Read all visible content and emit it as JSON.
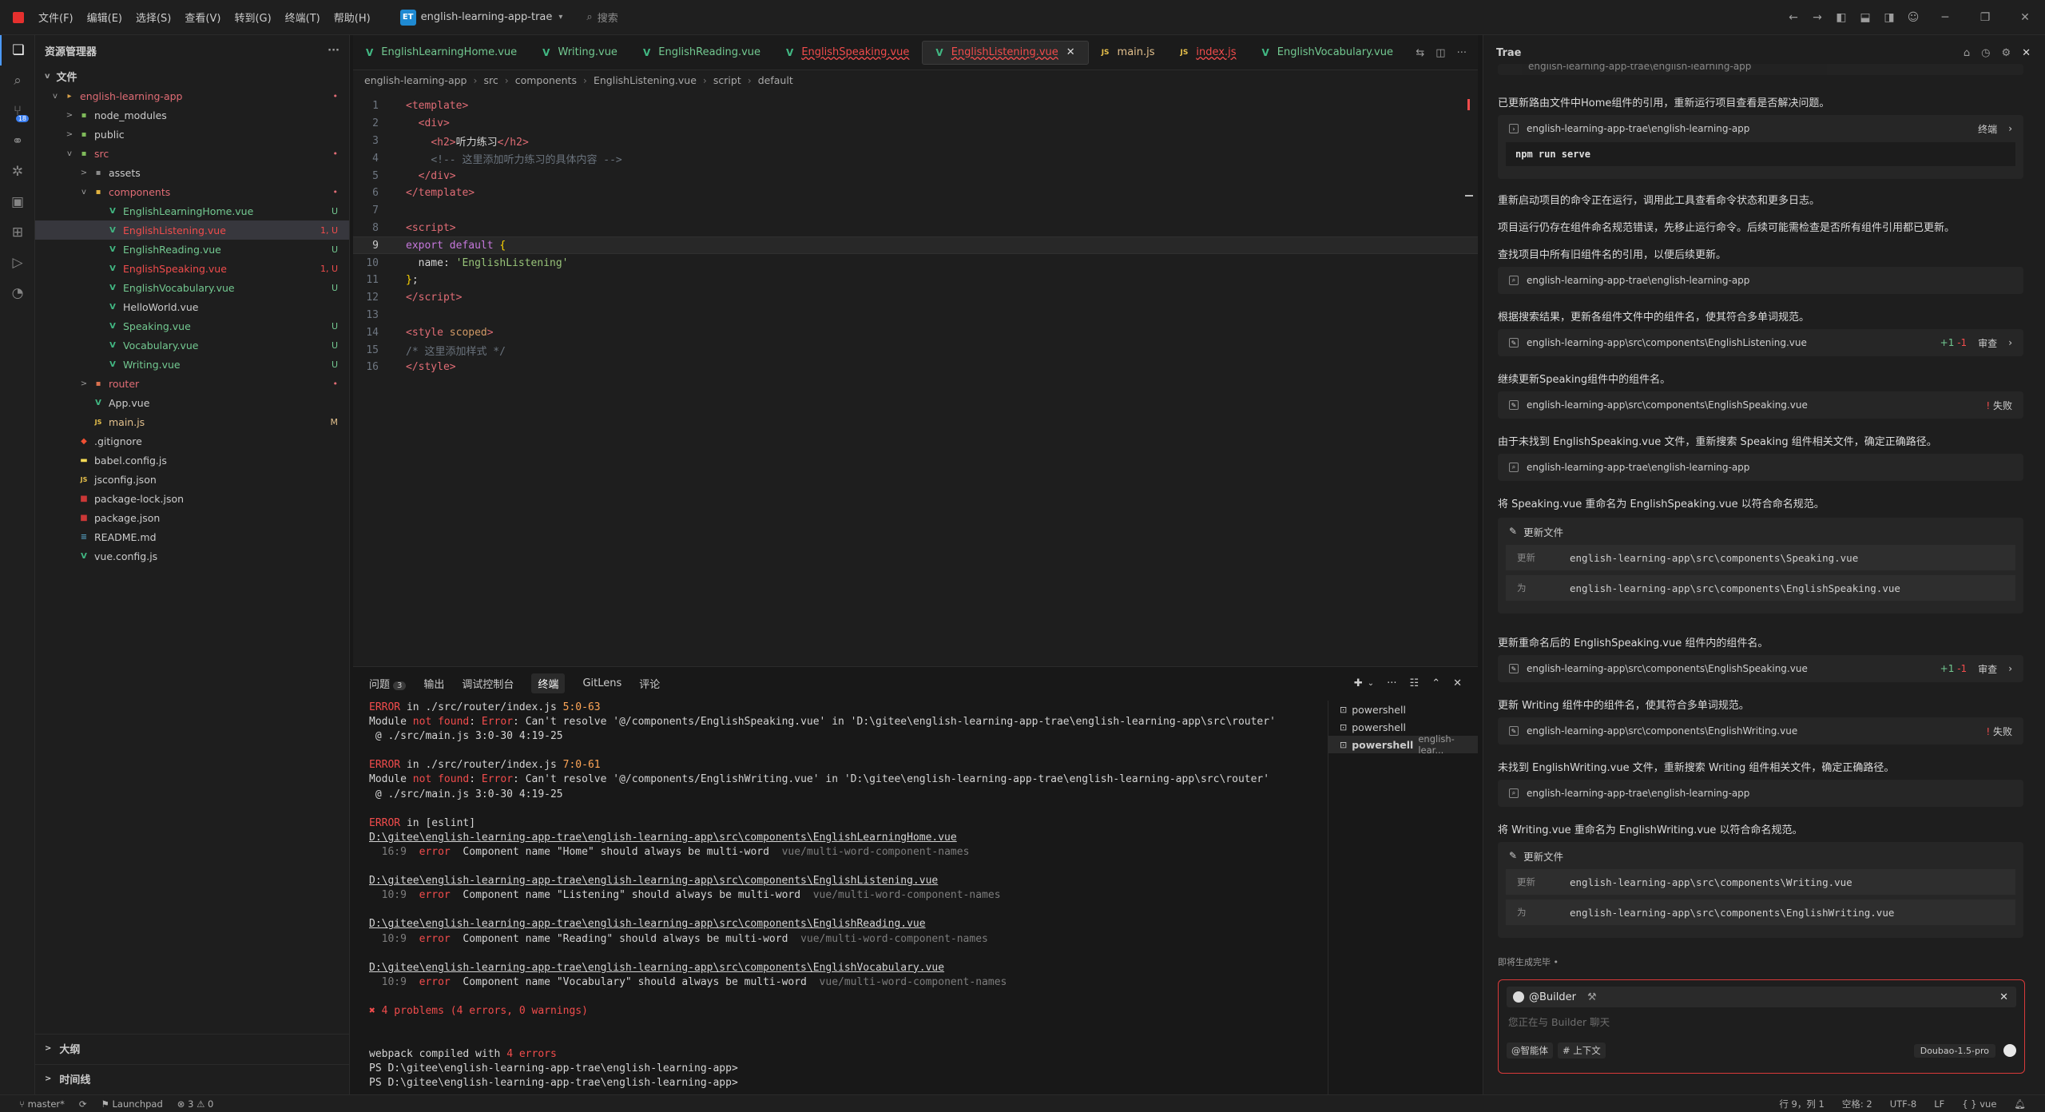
{
  "titlebar": {
    "menu": [
      "文件(F)",
      "编辑(E)",
      "选择(S)",
      "查看(V)",
      "转到(G)",
      "终端(T)",
      "帮助(H)"
    ],
    "project_badge": "ET",
    "project_name": "english-learning-app-trae",
    "search_placeholder": "搜索"
  },
  "activity": {
    "badge": "18"
  },
  "explorer": {
    "title": "资源管理器",
    "more": "···",
    "section": "文件",
    "tree": [
      {
        "label": "english-learning-app",
        "depth": 0,
        "chev": "v",
        "icon": "folder",
        "color": "pink",
        "badge": "•"
      },
      {
        "label": "node_modules",
        "depth": 1,
        "chev": ">",
        "icon": "folder-green",
        "color": "",
        "badge": ""
      },
      {
        "label": "public",
        "depth": 1,
        "chev": ">",
        "icon": "folder-green",
        "color": "",
        "badge": ""
      },
      {
        "label": "src",
        "depth": 1,
        "chev": "v",
        "icon": "folder-green",
        "color": "pink",
        "badge": "•"
      },
      {
        "label": "assets",
        "depth": 2,
        "chev": ">",
        "icon": "folder-grey",
        "color": "",
        "badge": ""
      },
      {
        "label": "components",
        "depth": 2,
        "chev": "v",
        "icon": "folder-yellow",
        "color": "pink",
        "badge": "•"
      },
      {
        "label": "EnglishLearningHome.vue",
        "depth": 3,
        "chev": "",
        "icon": "vue",
        "color": "green",
        "badge": "U"
      },
      {
        "label": "EnglishListening.vue",
        "depth": 3,
        "chev": "",
        "icon": "vue",
        "color": "red",
        "badge": "1, U",
        "selected": true
      },
      {
        "label": "EnglishReading.vue",
        "depth": 3,
        "chev": "",
        "icon": "vue",
        "color": "green",
        "badge": "U"
      },
      {
        "label": "EnglishSpeaking.vue",
        "depth": 3,
        "chev": "",
        "icon": "vue",
        "color": "red",
        "badge": "1, U"
      },
      {
        "label": "EnglishVocabulary.vue",
        "depth": 3,
        "chev": "",
        "icon": "vue",
        "color": "green",
        "badge": "U"
      },
      {
        "label": "HelloWorld.vue",
        "depth": 3,
        "chev": "",
        "icon": "vue",
        "color": "",
        "badge": ""
      },
      {
        "label": "Speaking.vue",
        "depth": 3,
        "chev": "",
        "icon": "vue",
        "color": "green",
        "badge": "U"
      },
      {
        "label": "Vocabulary.vue",
        "depth": 3,
        "chev": "",
        "icon": "vue",
        "color": "green",
        "badge": "U"
      },
      {
        "label": "Writing.vue",
        "depth": 3,
        "chev": "",
        "icon": "vue",
        "color": "green",
        "badge": "U"
      },
      {
        "label": "router",
        "depth": 2,
        "chev": ">",
        "icon": "folder-red",
        "color": "pink",
        "badge": "•"
      },
      {
        "label": "App.vue",
        "depth": 2,
        "chev": "",
        "icon": "vue",
        "color": "",
        "badge": ""
      },
      {
        "label": "main.js",
        "depth": 2,
        "chev": "",
        "icon": "js",
        "color": "yellow",
        "badge": "M"
      },
      {
        "label": ".gitignore",
        "depth": 1,
        "chev": "",
        "icon": "git",
        "color": "",
        "badge": ""
      },
      {
        "label": "babel.config.js",
        "depth": 1,
        "chev": "",
        "icon": "babel",
        "color": "",
        "badge": ""
      },
      {
        "label": "jsconfig.json",
        "depth": 1,
        "chev": "",
        "icon": "js",
        "color": "",
        "badge": ""
      },
      {
        "label": "package-lock.json",
        "depth": 1,
        "chev": "",
        "icon": "npm",
        "color": "",
        "badge": ""
      },
      {
        "label": "package.json",
        "depth": 1,
        "chev": "",
        "icon": "npm",
        "color": "",
        "badge": ""
      },
      {
        "label": "README.md",
        "depth": 1,
        "chev": "",
        "icon": "md",
        "color": "",
        "badge": ""
      },
      {
        "label": "vue.config.js",
        "depth": 1,
        "chev": "",
        "icon": "vue",
        "color": "",
        "badge": ""
      }
    ],
    "outline": "大纲",
    "timeline": "时间线"
  },
  "editor": {
    "tabs": [
      {
        "label": "EnglishLearningHome.vue",
        "icon": "V",
        "color": "green"
      },
      {
        "label": "Writing.vue",
        "icon": "V",
        "color": "green"
      },
      {
        "label": "EnglishReading.vue",
        "icon": "V",
        "color": "green"
      },
      {
        "label": "EnglishSpeaking.vue",
        "icon": "V",
        "color": "red-wavy"
      },
      {
        "label": "EnglishListening.vue",
        "icon": "V",
        "color": "red-wavy",
        "active": true
      },
      {
        "label": "main.js",
        "icon": "JS",
        "color": "yellow"
      },
      {
        "label": "index.js",
        "icon": "JS",
        "color": "red-wavy"
      },
      {
        "label": "EnglishVocabulary.vue",
        "icon": "V",
        "color": "green"
      }
    ],
    "breadcrumb": [
      "english-learning-app",
      "src",
      "components",
      "EnglishListening.vue",
      "script",
      "default"
    ],
    "lines": [
      {
        "n": "1",
        "html": "<span class='tok-tag'>&lt;template&gt;</span>"
      },
      {
        "n": "2",
        "html": "  <span class='tok-tag'>&lt;div&gt;</span>"
      },
      {
        "n": "3",
        "html": "    <span class='tok-tag'>&lt;h2&gt;</span><span class='tok-text'>听力练习</span><span class='tok-tag'>&lt;/h2&gt;</span>"
      },
      {
        "n": "4",
        "html": "    <span class='tok-cmt'>&lt;!-- 这里添加听力练习的具体内容 --&gt;</span>"
      },
      {
        "n": "5",
        "html": "  <span class='tok-tag'>&lt;/div&gt;</span>"
      },
      {
        "n": "6",
        "html": "<span class='tok-tag'>&lt;/template&gt;</span>"
      },
      {
        "n": "7",
        "html": ""
      },
      {
        "n": "8",
        "html": "<span class='tok-tag'>&lt;script&gt;</span>"
      },
      {
        "n": "9",
        "html": "<span class='tok-kw'>export default</span> <span class='tok-punc'>{</span>",
        "current": true
      },
      {
        "n": "10",
        "html": "  <span class='tok-text'>name</span><span class='tok-text'>: </span><span class='tok-str'>'EnglishListening'</span>"
      },
      {
        "n": "11",
        "html": "<span class='tok-punc'>}</span><span class='tok-text'>;</span>"
      },
      {
        "n": "12",
        "html": "<span class='tok-tag'>&lt;/script&gt;</span>"
      },
      {
        "n": "13",
        "html": ""
      },
      {
        "n": "14",
        "html": "<span class='tok-tag'>&lt;style</span> <span class='tok-attr'>scoped</span><span class='tok-tag'>&gt;</span>"
      },
      {
        "n": "15",
        "html": "<span class='tok-cmt'>/* 这里添加样式 */</span>"
      },
      {
        "n": "16",
        "html": "<span class='tok-tag'>&lt;/style&gt;</span>"
      }
    ]
  },
  "panel": {
    "tabs": [
      {
        "label": "问题",
        "badge": "3"
      },
      {
        "label": "输出"
      },
      {
        "label": "调试控制台"
      },
      {
        "label": "终端",
        "active": true
      },
      {
        "label": "GitLens"
      },
      {
        "label": "评论"
      }
    ],
    "terminal_lines": [
      "<span class='err'>ERROR</span> in ./src/router/index.js <span class='amber'>5:0-63</span>",
      "Module <span class='err'>not found</span>: <span class='err'>Error</span>: Can't resolve '@/components/EnglishSpeaking.vue' in 'D:\\gitee\\english-learning-app-trae\\english-learning-app\\src\\router'",
      " @ ./src/main.js 3:0-30 4:19-25",
      "",
      "<span class='err'>ERROR</span> in ./src/router/index.js <span class='amber'>7:0-61</span>",
      "Module <span class='err'>not found</span>: <span class='err'>Error</span>: Can't resolve '@/components/EnglishWriting.vue' in 'D:\\gitee\\english-learning-app-trae\\english-learning-app\\src\\router'",
      " @ ./src/main.js 3:0-30 4:19-25",
      "",
      "<span class='err'>ERROR</span> in [eslint]",
      "<span class='ulink'>D:\\gitee\\english-learning-app-trae\\english-learning-app\\src\\components\\EnglishLearningHome.vue</span>",
      "  <span class='dim'>16:9</span>  <span class='errlabel'>error</span>  Component name \"Home\" should always be multi-word  <span class='dim'>vue/multi-word-component-names</span>",
      "",
      "<span class='ulink'>D:\\gitee\\english-learning-app-trae\\english-learning-app\\src\\components\\EnglishListening.vue</span>",
      "  <span class='dim'>10:9</span>  <span class='errlabel'>error</span>  Component name \"Listening\" should always be multi-word  <span class='dim'>vue/multi-word-component-names</span>",
      "",
      "<span class='ulink'>D:\\gitee\\english-learning-app-trae\\english-learning-app\\src\\components\\EnglishReading.vue</span>",
      "  <span class='dim'>10:9</span>  <span class='errlabel'>error</span>  Component name \"Reading\" should always be multi-word  <span class='dim'>vue/multi-word-component-names</span>",
      "",
      "<span class='ulink'>D:\\gitee\\english-learning-app-trae\\english-learning-app\\src\\components\\EnglishVocabulary.vue</span>",
      "  <span class='dim'>10:9</span>  <span class='errlabel'>error</span>  Component name \"Vocabulary\" should always be multi-word  <span class='dim'>vue/multi-word-component-names</span>",
      "",
      "<span class='err'>✖ 4 problems (4 errors, 0 warnings)</span>",
      "",
      "",
      "webpack compiled with <span class='err'>4 errors</span>",
      "PS D:\\gitee\\english-learning-app-trae\\english-learning-app>",
      "PS D:\\gitee\\english-learning-app-trae\\english-learning-app>"
    ],
    "terminal_list": [
      {
        "label": "powershell",
        "extra": ""
      },
      {
        "label": "powershell",
        "extra": ""
      },
      {
        "label": "powershell",
        "extra": "english-lear...",
        "active": true
      }
    ]
  },
  "chat": {
    "title": "Trae",
    "top_partial": "english-learning-app-trae\\english-learning-app",
    "msg1": "已更新路由文件中Home组件的引用，重新运行项目查看是否解决问题。",
    "card1_path": "english-learning-app-trae\\english-learning-app",
    "card1_action": "终端",
    "card1_cmd": "npm run serve",
    "msg2": "重新启动项目的命令正在运行，调用此工具查看命令状态和更多日志。",
    "msg3": "项目运行仍存在组件命名规范错误，先移止运行命令。后续可能需检查是否所有组件引用都已更新。",
    "msg4": "查找项目中所有旧组件名的引用，以便后续更新。",
    "card2_path": "english-learning-app-trae\\english-learning-app",
    "msg5": "根据搜索结果，更新各组件文件中的组件名，使其符合多单词规范。",
    "card3_path": "english-learning-app\\src\\components\\EnglishListening.vue",
    "card3_diff_add": "+1",
    "card3_diff_del": "-1",
    "card3_action": "审查",
    "msg6": "继续更新Speaking组件中的组件名。",
    "card4_path": "english-learning-app\\src\\components\\EnglishSpeaking.vue",
    "card4_status": "失败",
    "msg7": "由于未找到 EnglishSpeaking.vue 文件，重新搜索 Speaking 组件相关文件，确定正确路径。",
    "card5_path": "english-learning-app-trae\\english-learning-app",
    "msg8": "将 Speaking.vue 重命名为 EnglishSpeaking.vue 以符合命名规范。",
    "upd1_title": "更新文件",
    "upd1_from_label": "更新",
    "upd1_from": "english-learning-app\\src\\components\\Speaking.vue",
    "upd1_to_label": "为",
    "upd1_to": "english-learning-app\\src\\components\\EnglishSpeaking.vue",
    "msg9": "更新重命名后的 EnglishSpeaking.vue 组件内的组件名。",
    "card6_path": "english-learning-app\\src\\components\\EnglishSpeaking.vue",
    "card6_diff_add": "+1",
    "card6_diff_del": "-1",
    "card6_action": "审查",
    "msg10": "更新 Writing 组件中的组件名，使其符合多单词规范。",
    "card7_path": "english-learning-app\\src\\components\\EnglishWriting.vue",
    "card7_status": "失败",
    "msg11": "未找到 EnglishWriting.vue 文件，重新搜索 Writing 组件相关文件，确定正确路径。",
    "card8_path": "english-learning-app-trae\\english-learning-app",
    "msg12": "将 Writing.vue 重命名为 EnglishWriting.vue 以符合命名规范。",
    "upd2_title": "更新文件",
    "upd2_from_label": "更新",
    "upd2_from": "english-learning-app\\src\\components\\Writing.vue",
    "upd2_to_label": "为",
    "upd2_to": "english-learning-app\\src\\components\\EnglishWriting.vue",
    "generating": "即将生成完毕 •",
    "input_agent": "@Builder",
    "input_placeholder": "您正在与 Builder 聊天",
    "input_agent_btn": "@智能体",
    "input_context_btn": "# 上下文",
    "input_model": "Doubao-1.5-pro"
  },
  "status": {
    "branch": "master*",
    "launchpad": "Launchpad",
    "errors": "3",
    "warnings": "0",
    "position": "行 9，列 1",
    "spaces": "空格: 2",
    "encoding": "UTF-8",
    "eol": "LF",
    "language": "vue"
  }
}
